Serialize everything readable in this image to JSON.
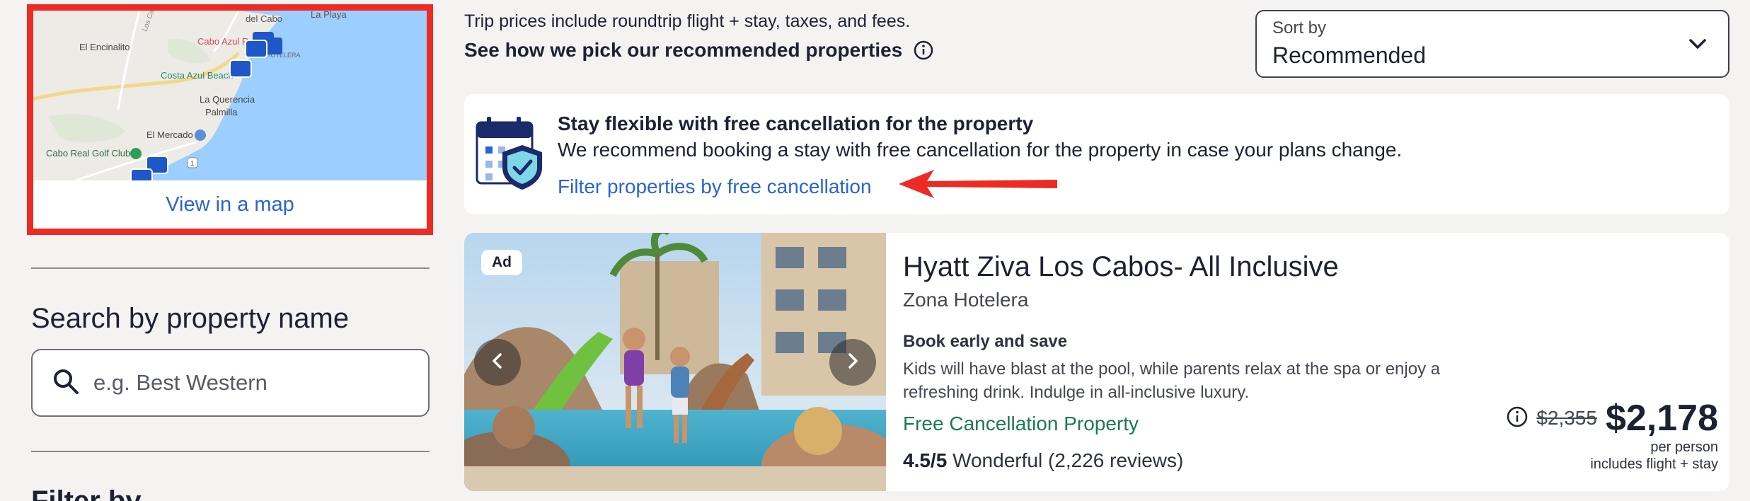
{
  "map": {
    "labels": {
      "cabo_region": "del Cabo",
      "la_playa": "La Playa",
      "los_cabos_road": "Los Cabo",
      "el_encinalito": "El Encinalito",
      "cabo_azul": "Cabo Azul R",
      "zona_hotelera": "ZONA HOTELERA",
      "costa_azul_beach": "Costa Azul Beach",
      "la_querencia": "La Querencia",
      "palmilla": "Palmilla",
      "el_mercado": "El Mercado",
      "cabo_real_golf": "Cabo Real Golf Club",
      "highway_shield": "1"
    },
    "link_label": "View in a map"
  },
  "search": {
    "title": "Search by property name",
    "placeholder": "e.g. Best Western"
  },
  "filter": {
    "title": "Filter by"
  },
  "header": {
    "trip_note": "Trip prices include roundtrip flight + stay, taxes, and fees.",
    "pick_link": "See how we pick our recommended properties"
  },
  "sort": {
    "label": "Sort by",
    "value": "Recommended"
  },
  "promo": {
    "title": "Stay flexible with free cancellation for the property",
    "description": "We recommend booking a stay with free cancellation for the property in case your plans change.",
    "link": "Filter properties by free cancellation"
  },
  "hotel": {
    "ad_badge": "Ad",
    "name": "Hyatt Ziva Los Cabos- All Inclusive",
    "area": "Zona Hotelera",
    "promo_title": "Book early and save",
    "promo_desc": "Kids will have blast at the pool, while parents relax at the spa or enjoy a refreshing drink. Indulge in all-inclusive luxury.",
    "cancellation": "Free Cancellation Property",
    "rating_score": "4.5/5",
    "rating_text": "Wonderful (2,226 reviews)",
    "old_price": "$2,355",
    "price": "$2,178",
    "per_person": "per person",
    "includes": "includes flight + stay"
  },
  "colors": {
    "accent_link": "#2a63d6",
    "highlight_border": "#ee2a24",
    "free_cancel_green": "#1d7a4e",
    "map_water": "#9ccfff",
    "icon_navy": "#1b2a6b"
  }
}
